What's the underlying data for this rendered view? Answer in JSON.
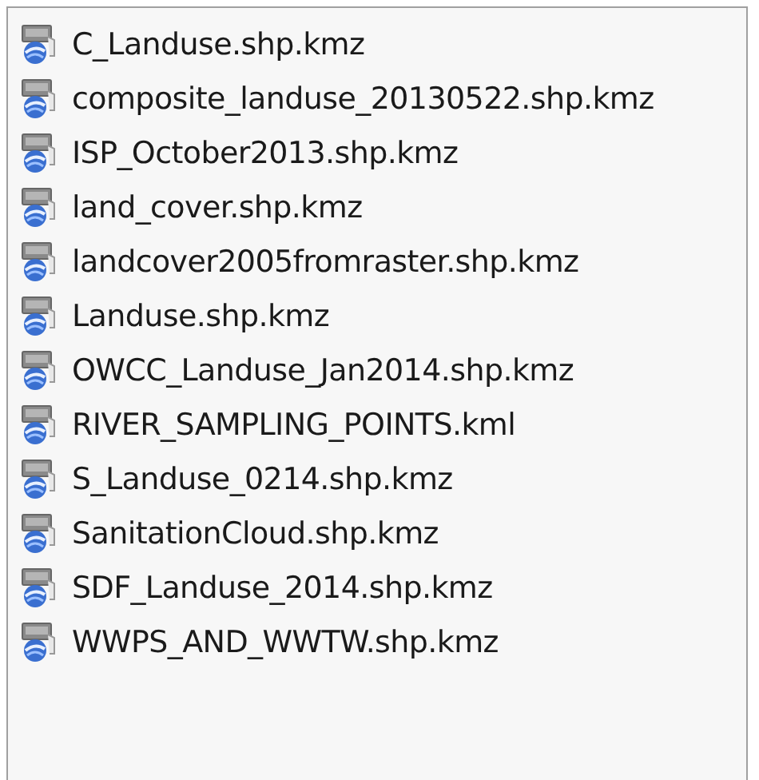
{
  "files": [
    {
      "name": "C_Landuse.shp.kmz"
    },
    {
      "name": "composite_landuse_20130522.shp.kmz"
    },
    {
      "name": "ISP_October2013.shp.kmz"
    },
    {
      "name": "land_cover.shp.kmz"
    },
    {
      "name": "landcover2005fromraster.shp.kmz"
    },
    {
      "name": "Landuse.shp.kmz"
    },
    {
      "name": "OWCC_Landuse_Jan2014.shp.kmz"
    },
    {
      "name": "RIVER_SAMPLING_POINTS.kml"
    },
    {
      "name": "S_Landuse_0214.shp.kmz"
    },
    {
      "name": "SanitationCloud.shp.kmz"
    },
    {
      "name": "SDF_Landuse_2014.shp.kmz"
    },
    {
      "name": "WWPS_AND_WWTW.shp.kmz"
    }
  ]
}
